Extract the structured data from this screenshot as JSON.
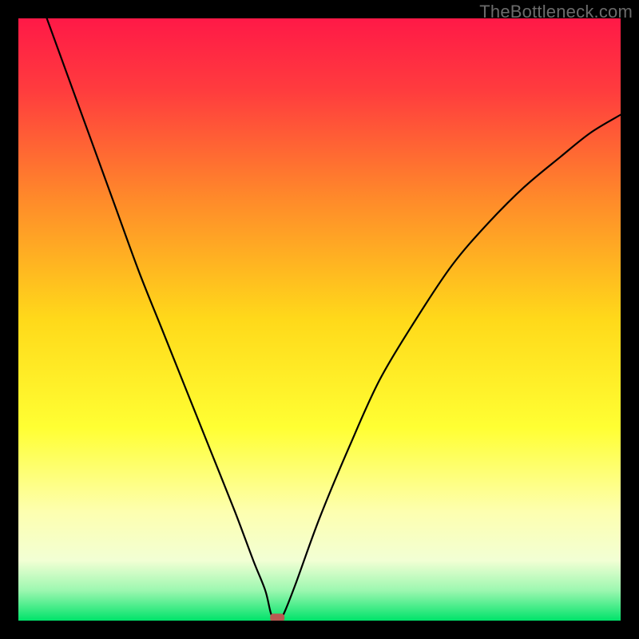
{
  "watermark": "TheBottleneck.com",
  "chart_data": {
    "type": "line",
    "title": "",
    "xlabel": "",
    "ylabel": "",
    "xlim": [
      0,
      100
    ],
    "ylim": [
      0,
      100
    ],
    "background": {
      "type": "vertical-gradient",
      "stops": [
        {
          "pct": 0,
          "color": "#ff1947"
        },
        {
          "pct": 12,
          "color": "#ff3c3e"
        },
        {
          "pct": 30,
          "color": "#ff8a2a"
        },
        {
          "pct": 50,
          "color": "#ffd91a"
        },
        {
          "pct": 68,
          "color": "#ffff33"
        },
        {
          "pct": 82,
          "color": "#fdffb0"
        },
        {
          "pct": 90,
          "color": "#f2ffd4"
        },
        {
          "pct": 95,
          "color": "#9cf7b0"
        },
        {
          "pct": 100,
          "color": "#00e36a"
        }
      ]
    },
    "vertex_marker": {
      "x": 43,
      "y": 0.5,
      "color": "#b85a52"
    },
    "series": [
      {
        "name": "bottleneck-curve",
        "color": "#000000",
        "x": [
          0,
          4,
          8,
          12,
          16,
          20,
          24,
          28,
          32,
          36,
          39,
          41,
          42,
          43,
          44,
          46,
          50,
          55,
          60,
          66,
          72,
          78,
          84,
          90,
          95,
          100
        ],
        "y": [
          113,
          102,
          91,
          80,
          69,
          58,
          48,
          38,
          28,
          18,
          10,
          5,
          1,
          0,
          1,
          6,
          17,
          29,
          40,
          50,
          59,
          66,
          72,
          77,
          81,
          84
        ]
      }
    ]
  }
}
